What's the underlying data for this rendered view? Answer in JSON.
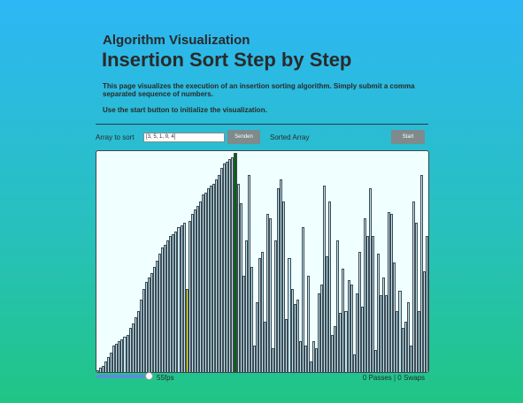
{
  "header": {
    "subtitle": "Algorithm Visualization",
    "title": "Insertion Sort Step by Step",
    "description": "This page visualizes the execution of an insertion sorting algorithm. Simply submit a comma separated sequence of numbers.",
    "hint": "Use the start button to initialize the visualization."
  },
  "controls": {
    "array_label": "Array to sort",
    "array_value": "[3, 5, 1, 9, 4]",
    "send_label": "Senden",
    "sorted_label": "Sorted Array",
    "start_label": "Start"
  },
  "visualization": {
    "colors": {
      "normal": "#bfe3ec",
      "active": "#ffff00",
      "current": "#006400",
      "border": "#3d4b55"
    },
    "max_value": 100,
    "values": [
      1,
      2,
      3,
      5,
      7,
      9,
      12,
      13,
      14,
      15,
      16,
      17,
      20,
      22,
      25,
      28,
      33,
      38,
      41,
      43,
      45,
      48,
      51,
      54,
      57,
      58,
      60,
      62,
      63,
      64,
      66,
      67,
      68,
      38,
      69,
      72,
      74,
      76,
      78,
      81,
      82,
      84,
      85,
      86,
      88,
      90,
      93,
      95,
      96,
      97,
      98,
      100,
      86,
      77,
      44,
      60,
      90,
      48,
      12,
      32,
      52,
      55,
      23,
      72,
      70,
      11,
      60,
      84,
      88,
      78,
      24,
      52,
      38,
      31,
      33,
      14,
      66,
      12,
      44,
      5,
      14,
      11,
      36,
      40,
      85,
      53,
      78,
      17,
      21,
      60,
      27,
      47,
      28,
      42,
      40,
      8,
      36,
      55,
      30,
      70,
      62,
      84,
      62,
      10,
      54,
      35,
      43,
      35,
      73,
      72,
      50,
      28,
      37,
      20,
      23,
      32,
      12,
      78,
      68,
      28,
      90,
      46,
      62
    ],
    "active_index": 33,
    "current_index": 51,
    "fps_label": "55fps",
    "status_label": "0 Passes | 0 Swaps"
  }
}
